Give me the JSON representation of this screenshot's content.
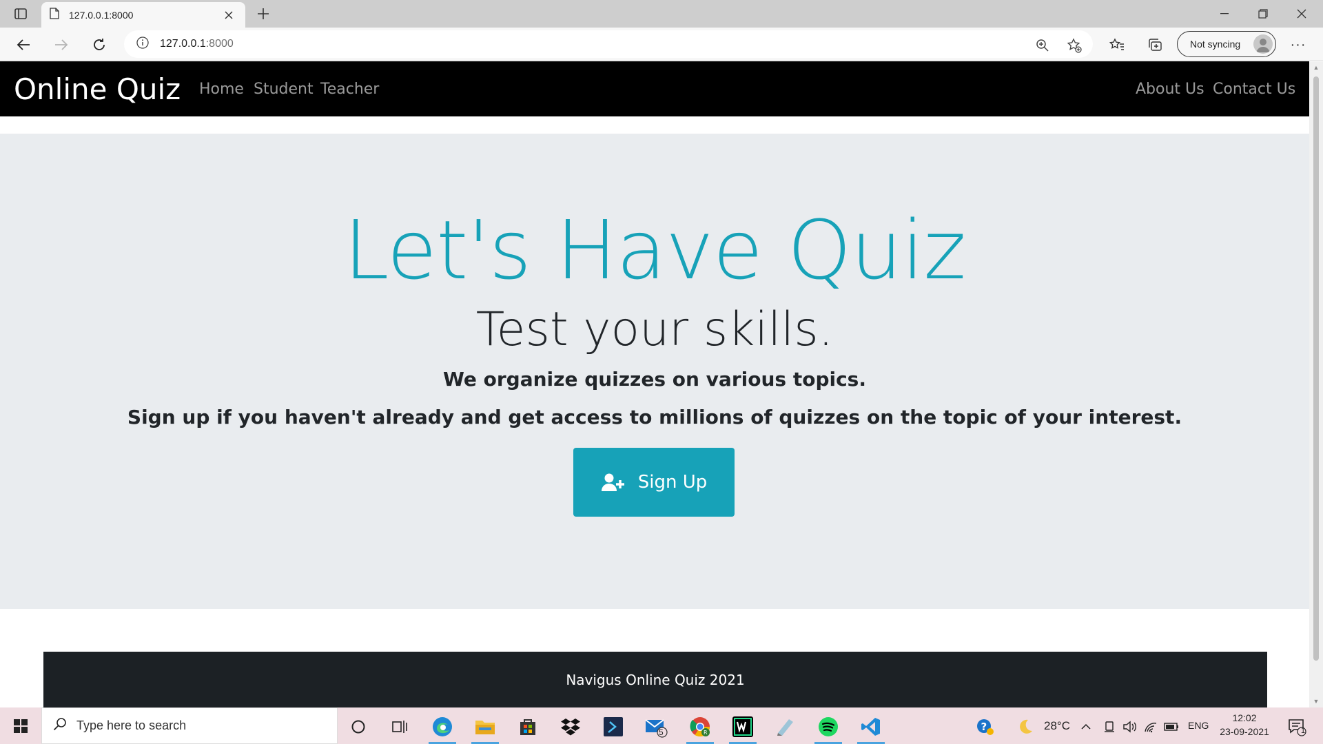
{
  "browser": {
    "tab_title": "127.0.0.1:8000",
    "url_host": "127.0.0.1",
    "url_port": ":8000",
    "sync_label": "Not syncing"
  },
  "navbar": {
    "brand": "Online Quiz",
    "left_links": [
      "Home",
      "Student",
      "Teacher"
    ],
    "right_links": [
      "About Us",
      "Contact Us"
    ]
  },
  "hero": {
    "title": "Let's Have Quiz",
    "subtitle": "Test your skills.",
    "line1": "We organize quizzes on various topics.",
    "line2": "Sign up if you haven't already and get access to millions of quizzes on the topic of your interest.",
    "signup_label": "Sign Up"
  },
  "footer": {
    "text": "Navigus Online Quiz 2021"
  },
  "taskbar": {
    "search_placeholder": "Type here to search",
    "mail_badge": "5",
    "weather": "28°C",
    "language": "ENG",
    "time": "12:02",
    "date": "23-09-2021",
    "notification_count": "1"
  },
  "colors": {
    "accent": "#17a2b8",
    "navbar": "#000000",
    "jumbotron": "#e9ecef",
    "footer": "#1c2125"
  }
}
